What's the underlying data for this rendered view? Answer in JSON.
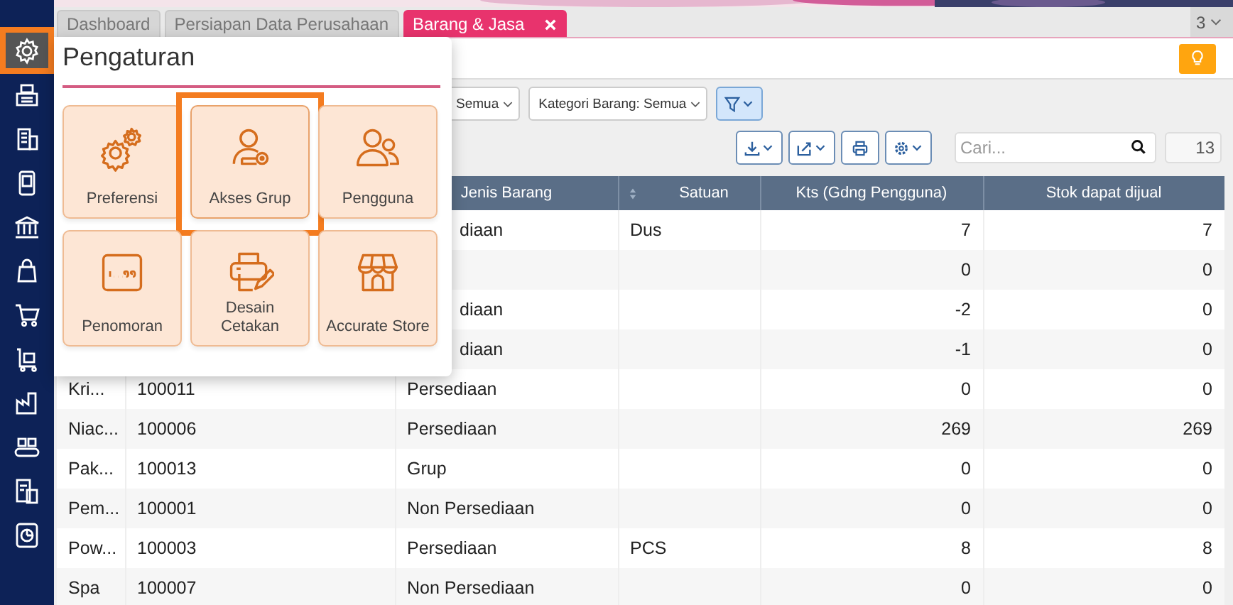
{
  "sidebar": {
    "items": [
      {
        "highlighted": true
      },
      {
        "highlighted": false
      },
      {
        "highlighted": false
      },
      {
        "highlighted": false
      },
      {
        "highlighted": false
      },
      {
        "highlighted": false
      },
      {
        "highlighted": false
      },
      {
        "highlighted": false
      },
      {
        "highlighted": false
      },
      {
        "highlighted": false
      },
      {
        "highlighted": false
      },
      {
        "highlighted": false
      }
    ]
  },
  "tabs": [
    {
      "label": "Dashboard",
      "selected": false,
      "closable": false
    },
    {
      "label": "Persiapan Data Perusahaan",
      "selected": false,
      "closable": false
    },
    {
      "label": "Barang & Jasa",
      "selected": true,
      "closable": true
    }
  ],
  "tab_count": "3",
  "filters": [
    {
      "label": "Semua"
    },
    {
      "label": "Kategori Barang: Semua"
    }
  ],
  "search": {
    "placeholder": "Cari..."
  },
  "record_count": "13",
  "table": {
    "columns": [
      null,
      null,
      "Jenis Barang",
      "Satuan",
      "Kts (Gdng Pengguna)",
      "Stok dapat dijual"
    ],
    "rows": [
      {
        "cells": [
          null,
          null,
          "diaan",
          "Dus",
          "7",
          "7"
        ]
      },
      {
        "cells": [
          null,
          null,
          "",
          "",
          "0",
          "0"
        ]
      },
      {
        "cells": [
          null,
          null,
          "diaan",
          "",
          "-2",
          "0"
        ]
      },
      {
        "cells": [
          null,
          null,
          "diaan",
          "",
          "-1",
          "0"
        ]
      },
      {
        "cells": [
          "Kri...",
          "100011",
          "Persediaan",
          "",
          "0",
          "0"
        ]
      },
      {
        "cells": [
          "Niac...",
          "100006",
          "Persediaan",
          "",
          "269",
          "269"
        ]
      },
      {
        "cells": [
          "Pak...",
          "100013",
          "Grup",
          "",
          "0",
          "0"
        ]
      },
      {
        "cells": [
          "Pem...",
          "100001",
          "Non Persediaan",
          "",
          "0",
          "0"
        ]
      },
      {
        "cells": [
          "Pow...",
          "100003",
          "Persediaan",
          "PCS",
          "8",
          "8"
        ]
      },
      {
        "cells": [
          "Spa",
          "100007",
          "Non Persediaan",
          "",
          "0",
          "0"
        ]
      }
    ]
  },
  "settings_menu": {
    "title": "Pengaturan",
    "tiles": [
      {
        "label": "Preferensi",
        "highlighted": false
      },
      {
        "label": "Akses Grup",
        "highlighted": true
      },
      {
        "label": "Pengguna",
        "highlighted": false
      },
      {
        "label": "Penomoran",
        "highlighted": false
      },
      {
        "label": "Desain Cetakan",
        "highlighted": false
      },
      {
        "label": "Accurate Store",
        "highlighted": false
      }
    ]
  }
}
